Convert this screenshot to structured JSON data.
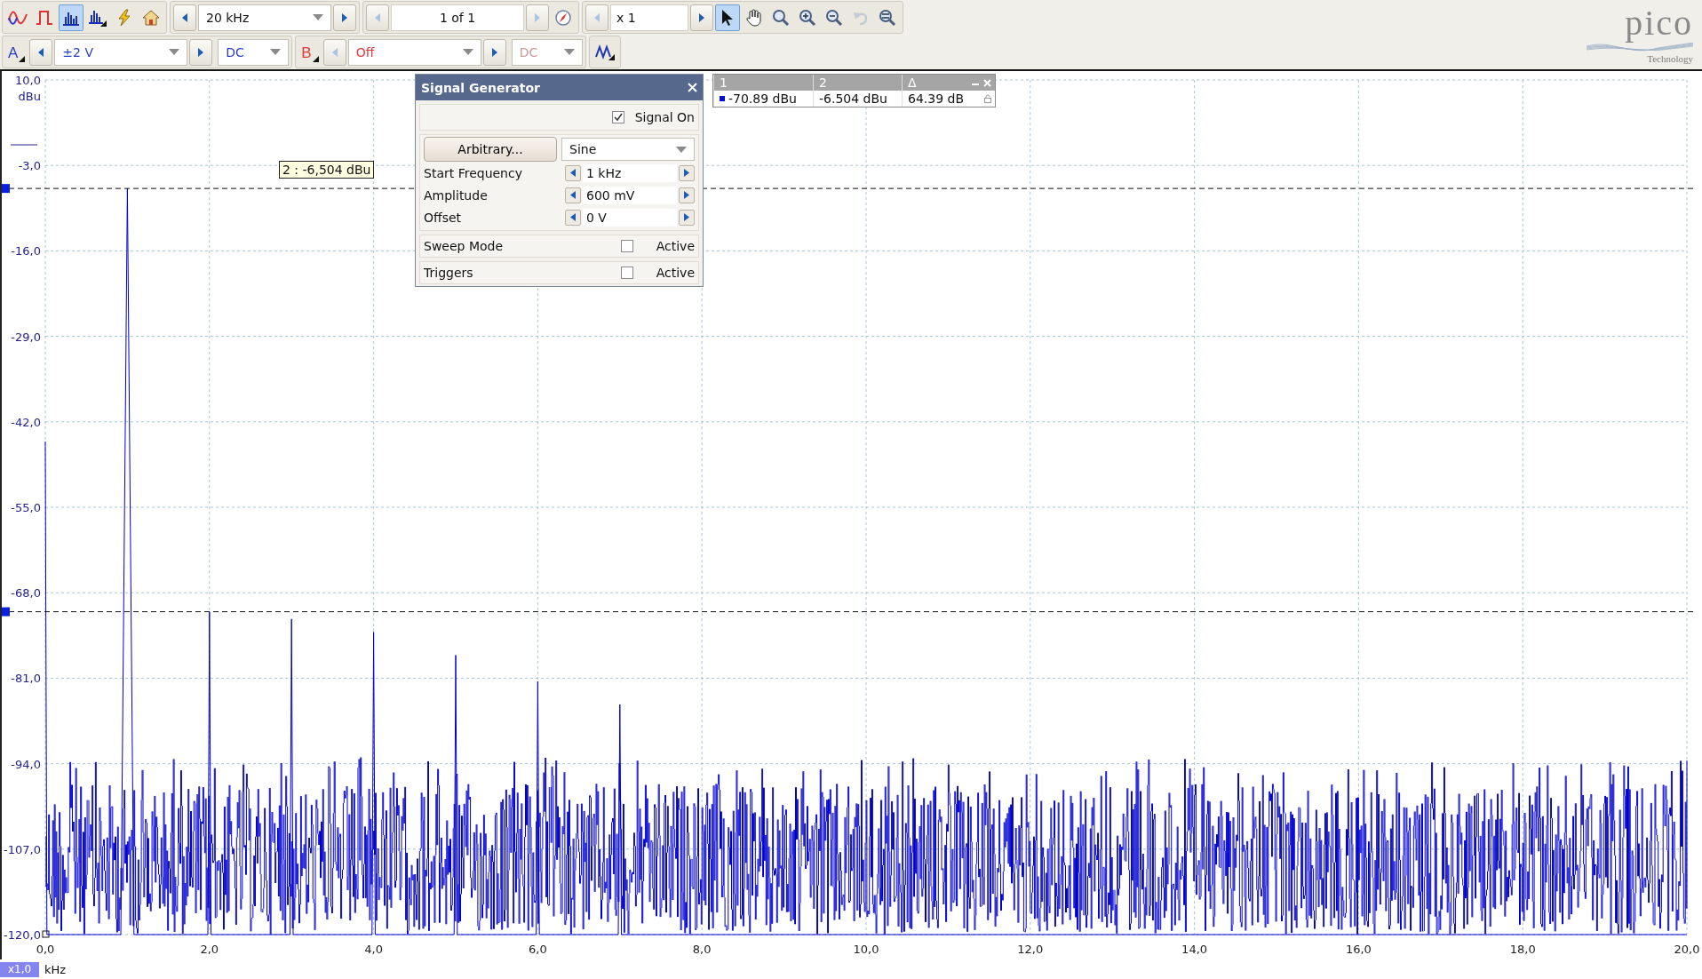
{
  "toolbar": {
    "view_tools": [
      {
        "kind": "scope",
        "selected": false
      },
      {
        "kind": "persistence",
        "selected": false
      },
      {
        "kind": "spectrum",
        "selected": true
      },
      {
        "kind": "spectrum_options",
        "selected": false
      },
      {
        "kind": "auto_setup",
        "selected": false
      },
      {
        "kind": "default_setup",
        "selected": false
      }
    ],
    "timebase": {
      "value": "20 kHz",
      "prev_disabled": false,
      "next_disabled": false
    },
    "buffer": {
      "value": "1 of 1",
      "prev_disabled": true,
      "next_disabled": true
    },
    "zoom": {
      "value": "x 1",
      "prev_disabled": true,
      "next_disabled": false
    },
    "tools": [
      {
        "kind": "pointer",
        "selected": true,
        "disabled": false
      },
      {
        "kind": "hand",
        "selected": false,
        "disabled": false
      },
      {
        "kind": "zoom",
        "selected": false,
        "disabled": false
      },
      {
        "kind": "zoom_in",
        "selected": false,
        "disabled": false
      },
      {
        "kind": "zoom_out",
        "selected": false,
        "disabled": false
      },
      {
        "kind": "undo_zoom",
        "selected": false,
        "disabled": true
      },
      {
        "kind": "zoom_fit",
        "selected": false,
        "disabled": false
      }
    ]
  },
  "channels": [
    {
      "label": "A",
      "color": "#2a3fc8",
      "range": "±2 V",
      "coupling": "DC",
      "prev_disabled": false,
      "coupling_disabled": false
    },
    {
      "label": "B",
      "color": "#e03a3a",
      "range": "Off",
      "coupling": "DC",
      "prev_disabled": true,
      "coupling_disabled": true
    }
  ],
  "logo": {
    "name": "pico",
    "subtitle": "Technology"
  },
  "spectrum": {
    "x_scale": "x1,0",
    "ruler_tooltip": "2 : -6,504 dBu",
    "chart_data": {
      "type": "line",
      "xlabel": "kHz",
      "ylabel": "dBu",
      "x": [
        0,
        0.02,
        0.92,
        1,
        1.08,
        1.98,
        2,
        2.02,
        2.98,
        3,
        3.02,
        3.98,
        4,
        4.02,
        4.98,
        5,
        5.02,
        5.98,
        6,
        6.02,
        6.98,
        7,
        7.02,
        20
      ],
      "series": [
        {
          "color": "#0000d0",
          "values": [
            -45,
            -120,
            -120,
            -6.5,
            -120,
            -120,
            -70.9,
            -120,
            -120,
            -72,
            -120,
            -120,
            -74,
            -120,
            -120,
            -77.5,
            -120,
            -120,
            -81.5,
            -120,
            -120,
            -85,
            -120,
            -120
          ]
        }
      ],
      "xlim": [
        0,
        20
      ],
      "ylim": [
        -120,
        10
      ],
      "grid": true,
      "ref_lines": [
        {
          "axis": "y",
          "value": -6.504
        },
        {
          "axis": "y",
          "value": -70.89
        }
      ],
      "xticks": [
        {
          "value": 0,
          "label": "0,0"
        },
        {
          "value": 2,
          "label": "2,0"
        },
        {
          "value": 4,
          "label": "4,0"
        },
        {
          "value": 6,
          "label": "6,0"
        },
        {
          "value": 8,
          "label": "8,0"
        },
        {
          "value": 10,
          "label": "10,0"
        },
        {
          "value": 12,
          "label": "12,0"
        },
        {
          "value": 14,
          "label": "14,0"
        },
        {
          "value": 16,
          "label": "16,0"
        },
        {
          "value": 18,
          "label": "18,0"
        },
        {
          "value": 20,
          "label": "20,0"
        }
      ],
      "yticks": [
        {
          "value": 10,
          "label": "10,0"
        },
        {
          "value": -3,
          "label": "-3,0"
        },
        {
          "value": -16,
          "label": "-16,0"
        },
        {
          "value": -29,
          "label": "-29,0"
        },
        {
          "value": -42,
          "label": "-42,0"
        },
        {
          "value": -55,
          "label": "-55,0"
        },
        {
          "value": -68,
          "label": "-68,0"
        },
        {
          "value": -81,
          "label": "-81,0"
        },
        {
          "value": -94,
          "label": "-94,0"
        },
        {
          "value": -107,
          "label": "-107,0"
        },
        {
          "value": -120,
          "label": "-120,0"
        }
      ]
    }
  },
  "signal_generator": {
    "title": "Signal Generator",
    "signal_on": {
      "label": "Signal On",
      "checked": true
    },
    "arbitrary_button": "Arbitrary...",
    "waveform": "Sine",
    "fields": [
      {
        "label": "Start Frequency",
        "value": "1 kHz"
      },
      {
        "label": "Amplitude",
        "value": "600 mV"
      },
      {
        "label": "Offset",
        "value": "0 V"
      }
    ],
    "options": [
      {
        "label": "Sweep Mode",
        "checkbox_label": "Active",
        "checked": false
      },
      {
        "label": "Triggers",
        "checkbox_label": "Active",
        "checked": false
      }
    ]
  },
  "rulers_table": {
    "columns": [
      "1",
      "2",
      "Δ"
    ],
    "row": [
      "-70.89 dBu",
      "-6.504 dBu",
      "64.39 dB"
    ]
  }
}
